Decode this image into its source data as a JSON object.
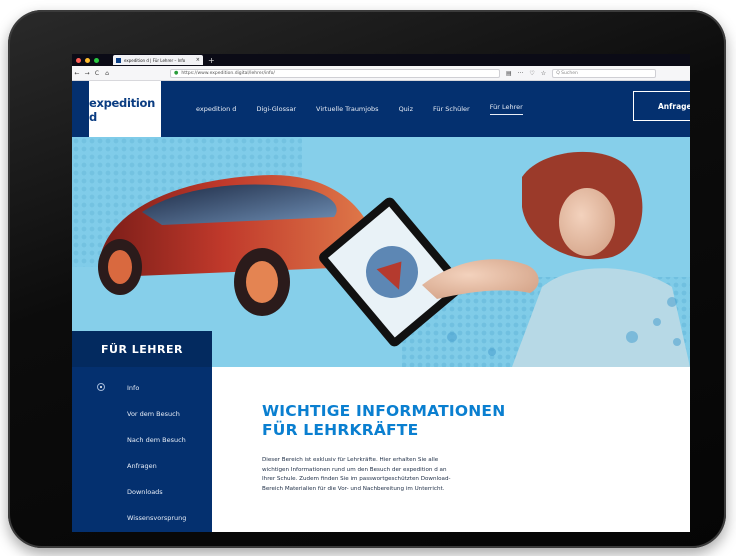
{
  "browser": {
    "tab_title": "expedition d | Für Lehrer – Info",
    "tab_close": "×",
    "new_tab": "+",
    "nav": {
      "back": "←",
      "forward": "→",
      "reload": "C",
      "home": "⌂"
    },
    "url": "https://www.expedition.digital/lehrer/info/",
    "tools": {
      "reader": "▤",
      "more": "···",
      "pocket": "♡",
      "bookmark": "☆"
    },
    "search_placeholder": "Q Suchen"
  },
  "site": {
    "logo": "expedition d",
    "nav_items": [
      "expedition d",
      "Digi-Glossar",
      "Virtuelle Traumjobs",
      "Quiz",
      "Für Schüler",
      "Für Lehrer"
    ],
    "active_nav": "Für Lehrer",
    "cta_button": "Anfragen"
  },
  "sidebar": {
    "title": "FÜR LEHRER",
    "items": [
      "Info",
      "Vor dem Besuch",
      "Nach dem Besuch",
      "Anfragen",
      "Downloads",
      "Wissensvorsprung"
    ],
    "active_item": "Info"
  },
  "content": {
    "heading_line1": "WICHTIGE INFORMATIONEN",
    "heading_line2": "FÜR LEHRKRÄFTE",
    "body_lines": [
      "Dieser Bereich ist exklusiv für Lehrkräfte. Hier erhalten Sie alle",
      "wichtigen Informationen rund um den Besuch der expedition d an",
      "Ihrer Schule. Zudem finden Sie im passwortgeschützten Download-",
      "Bereich Materialien für die Vor- und Nachbereitung im Unterricht."
    ]
  },
  "colors": {
    "brand_navy": "#04306f",
    "heading_blue": "#0a7fd0",
    "hero_sky": "#7ecbe8",
    "car_red": "#c0392b"
  }
}
